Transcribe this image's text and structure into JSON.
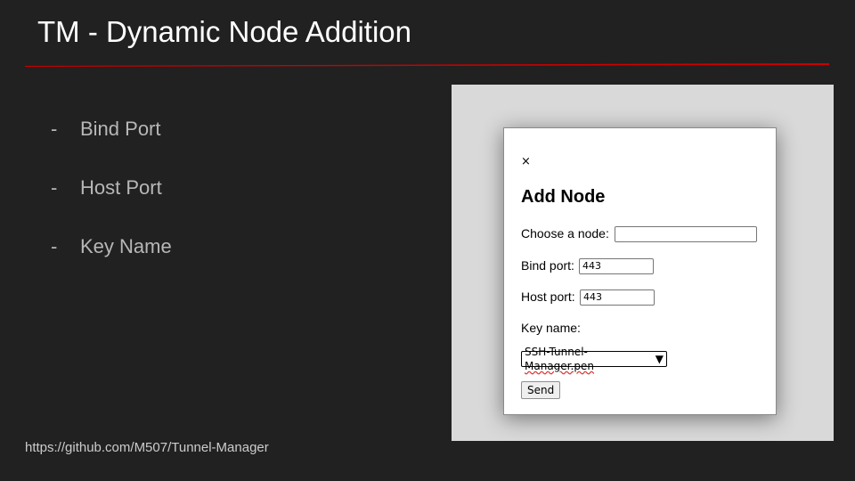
{
  "slide": {
    "title": "TM - Dynamic Node Addition",
    "accent_color": "#cc0000",
    "bullets": [
      {
        "marker": "-",
        "text": "Bind Port"
      },
      {
        "marker": "-",
        "text": "Host Port"
      },
      {
        "marker": "-",
        "text": "Key Name"
      }
    ],
    "footer_link": "https://github.com/M507/Tunnel-Manager"
  },
  "modal": {
    "close_icon": "×",
    "title": "Add Node",
    "choose_node_label": "Choose a node:",
    "choose_node_value": "",
    "bind_port_label": "Bind port:",
    "bind_port_value": "443",
    "host_port_label": "Host port:",
    "host_port_value": "443",
    "key_name_label": "Key name:",
    "key_select_prefix": "SSH-Tunnel-",
    "key_select_misspelled": "Manager.pen",
    "key_select_arrow": "▼",
    "send_label": "Send"
  }
}
